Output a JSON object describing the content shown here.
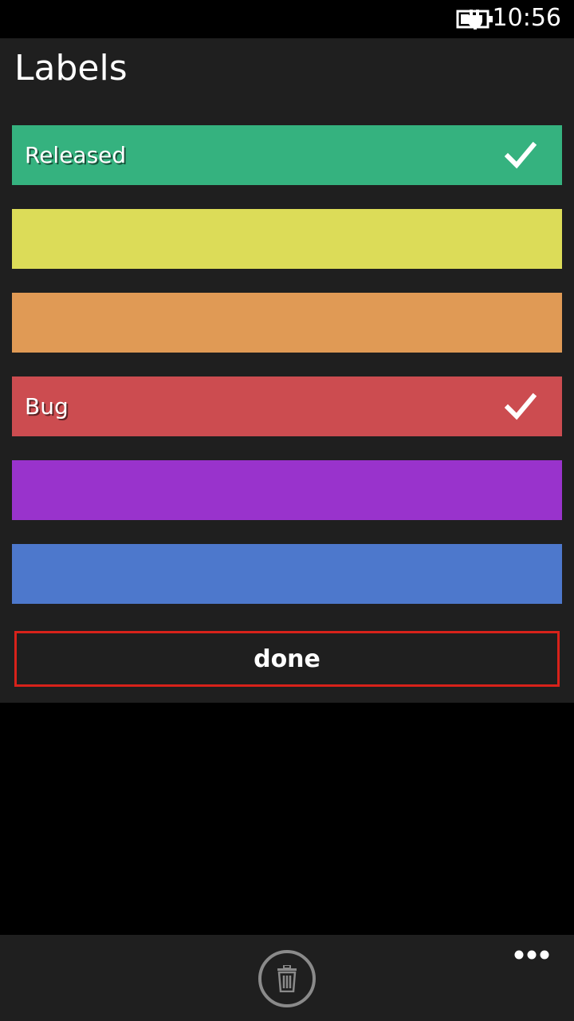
{
  "status_bar": {
    "time": "10:56",
    "battery_icon": "battery-charging-icon"
  },
  "page": {
    "title": "Labels"
  },
  "labels": [
    {
      "name": "Released",
      "color": "#35b27f",
      "checked": true
    },
    {
      "name": "",
      "color": "#dcdc58",
      "checked": false
    },
    {
      "name": "",
      "color": "#e09a55",
      "checked": false
    },
    {
      "name": "Bug",
      "color": "#cc4c50",
      "checked": true
    },
    {
      "name": "",
      "color": "#9933cc",
      "checked": false
    },
    {
      "name": "",
      "color": "#4d78cc",
      "checked": false
    }
  ],
  "done_button": {
    "label": "done",
    "border_color": "#d8221a"
  },
  "app_bar": {
    "delete_icon": "trash-icon",
    "more_icon": "ellipsis-icon"
  },
  "colors": {
    "panel_background": "#1f1f1f",
    "page_background": "#000000"
  }
}
